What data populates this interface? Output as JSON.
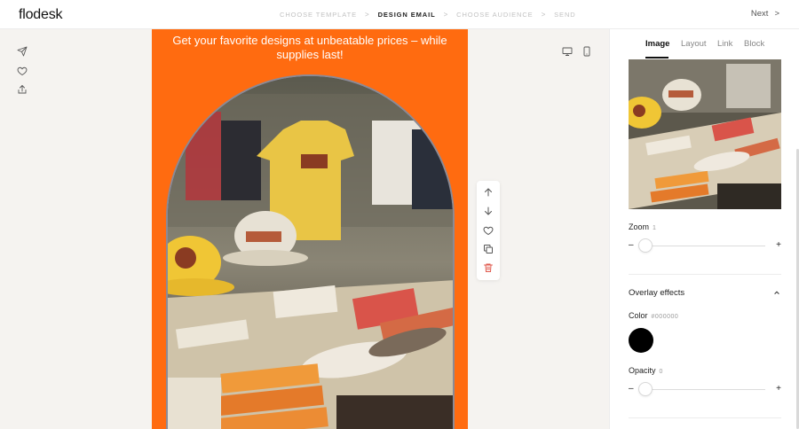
{
  "app": {
    "logo": "flodesk"
  },
  "steps": [
    {
      "label": "CHOOSE TEMPLATE",
      "active": false
    },
    {
      "label": "DESIGN EMAIL",
      "active": true
    },
    {
      "label": "CHOOSE AUDIENCE",
      "active": false
    },
    {
      "label": "SEND",
      "active": false
    }
  ],
  "step_separator": ">",
  "next": {
    "label": "Next",
    "arrow": ">"
  },
  "left_rail": [
    "send-icon",
    "heart-icon",
    "share-icon"
  ],
  "email": {
    "heading": "Get your favorite designs at unbeatable prices – while supplies last!",
    "background": "#ff6b10"
  },
  "block_toolbar": [
    "arrow-up-icon",
    "arrow-down-icon",
    "heart-icon",
    "duplicate-icon",
    "trash-icon"
  ],
  "devices": [
    "desktop-icon",
    "mobile-icon"
  ],
  "panel": {
    "tabs": [
      "Image",
      "Layout",
      "Link",
      "Block"
    ],
    "active_tab": "Image",
    "zoom": {
      "label": "Zoom",
      "value": "1",
      "minus": "–",
      "plus": "+"
    },
    "overlay": {
      "title": "Overlay effects",
      "color_label": "Color",
      "color_value": "#000000",
      "color_swatch": "#000000",
      "opacity_label": "Opacity",
      "opacity_value": "0",
      "minus": "–",
      "plus": "+"
    }
  },
  "colors": {
    "accent": "#ff6b10",
    "delete": "#e05a4e"
  }
}
